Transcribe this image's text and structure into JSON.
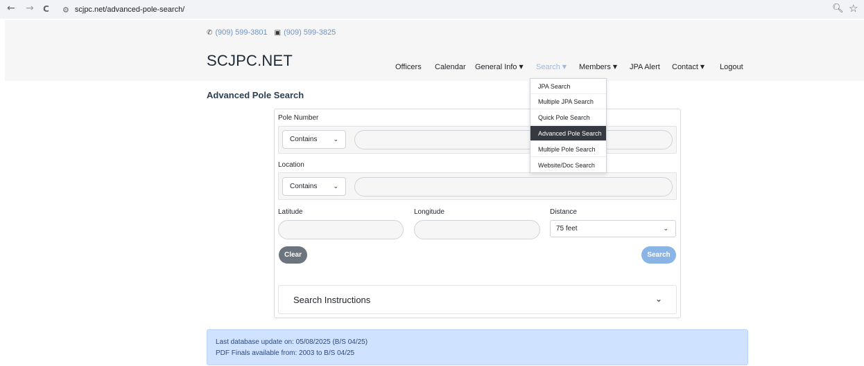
{
  "browser": {
    "back_icon": "←",
    "forward_icon": "→",
    "reload_icon": "C",
    "site_icon": "tune-icon",
    "url": "scjpc.net/advanced-pole-search/",
    "zoom_icon": "zoom-icon",
    "bookmark_icon": "star-icon"
  },
  "header": {
    "phone": "(909) 599-3801",
    "fax": "(909) 599-3825",
    "brand": "SCJPC.NET"
  },
  "nav": {
    "items": [
      {
        "label": "Officers"
      },
      {
        "label": "Calendar"
      },
      {
        "label": "General Info"
      },
      {
        "label": "Search"
      },
      {
        "label": "Members"
      },
      {
        "label": "JPA Alert"
      },
      {
        "label": "Contact"
      },
      {
        "label": "Logout"
      }
    ]
  },
  "search_menu": {
    "items": [
      {
        "label": "JPA Search"
      },
      {
        "label": "Multiple JPA Search"
      },
      {
        "label": "Quick Pole Search"
      },
      {
        "label": "Advanced Pole Search"
      },
      {
        "label": "Multiple Pole Search"
      },
      {
        "label": "Website/Doc Search"
      }
    ],
    "active": "Advanced Pole Search"
  },
  "page": {
    "title": "Advanced Pole Search"
  },
  "form": {
    "pole_number_label": "Pole Number",
    "pole_number_operator": "Contains",
    "pole_number_value": "",
    "location_label": "Location",
    "location_operator": "Contains",
    "location_value": "",
    "latitude_label": "Latitude",
    "latitude_value": "",
    "longitude_label": "Longitude",
    "longitude_value": "",
    "distance_label": "Distance",
    "distance_value": "75 feet",
    "clear_label": "Clear",
    "search_label": "Search",
    "instructions_label": "Search Instructions"
  },
  "info": {
    "line1": "Last database update on: 05/08/2025 (B/S 04/25)",
    "line2": "PDF Finals available from: 2003 to B/S 04/25"
  },
  "colors": {
    "accent": "#8ab4e6",
    "alert_bg": "#cfe2ff",
    "active_menu": "#343a40"
  }
}
